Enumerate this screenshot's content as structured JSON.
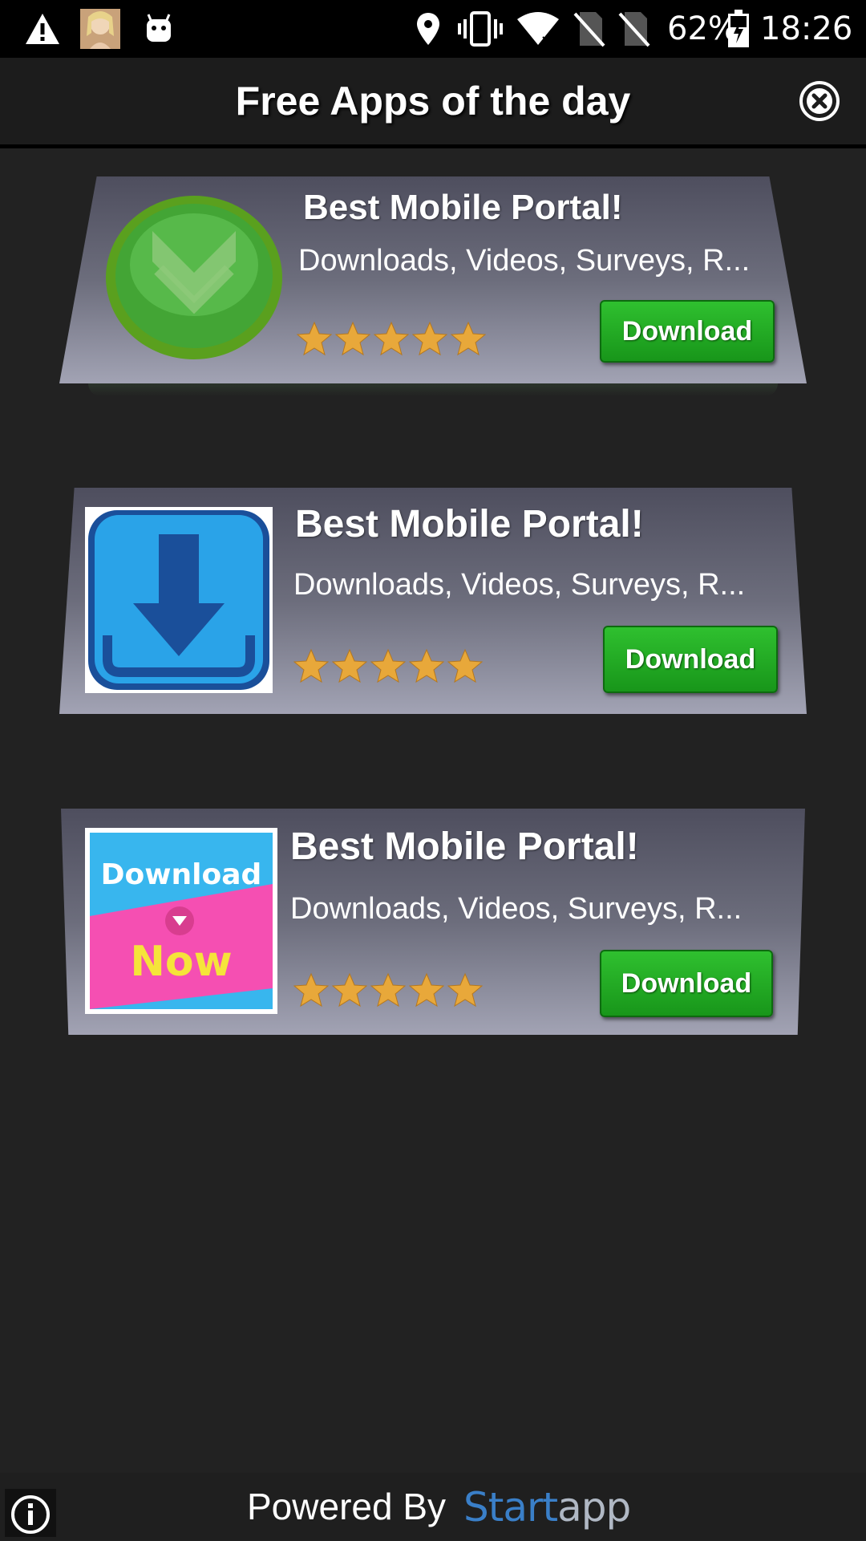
{
  "status_bar": {
    "battery": "62%",
    "time": "18:26"
  },
  "header": {
    "title": "Free Apps of the day"
  },
  "cards": [
    {
      "title": "Best Mobile Portal!",
      "description": "Downloads, Videos, Surveys, R...",
      "rating": 5,
      "button": "Download",
      "icon": "green-check-icon"
    },
    {
      "title": "Best Mobile Portal!",
      "description": "Downloads, Videos, Surveys, R...",
      "rating": 5,
      "button": "Download",
      "icon": "blue-download-icon"
    },
    {
      "title": "Best Mobile Portal!",
      "description": "Downloads, Videos, Surveys, R...",
      "rating": 5,
      "button": "Download",
      "icon": "download-now-icon",
      "icon_text_top": "Download",
      "icon_text_bottom": "Now"
    }
  ],
  "footer": {
    "powered_by": "Powered By",
    "logo_main": "Start",
    "logo_suffix": "app"
  },
  "colors": {
    "background": "#222222",
    "button_green": "#22a822",
    "card_gradient_top": "#4e4e5e",
    "card_gradient_bottom": "#a2a3b4",
    "star_gold": "#e8a83a"
  }
}
